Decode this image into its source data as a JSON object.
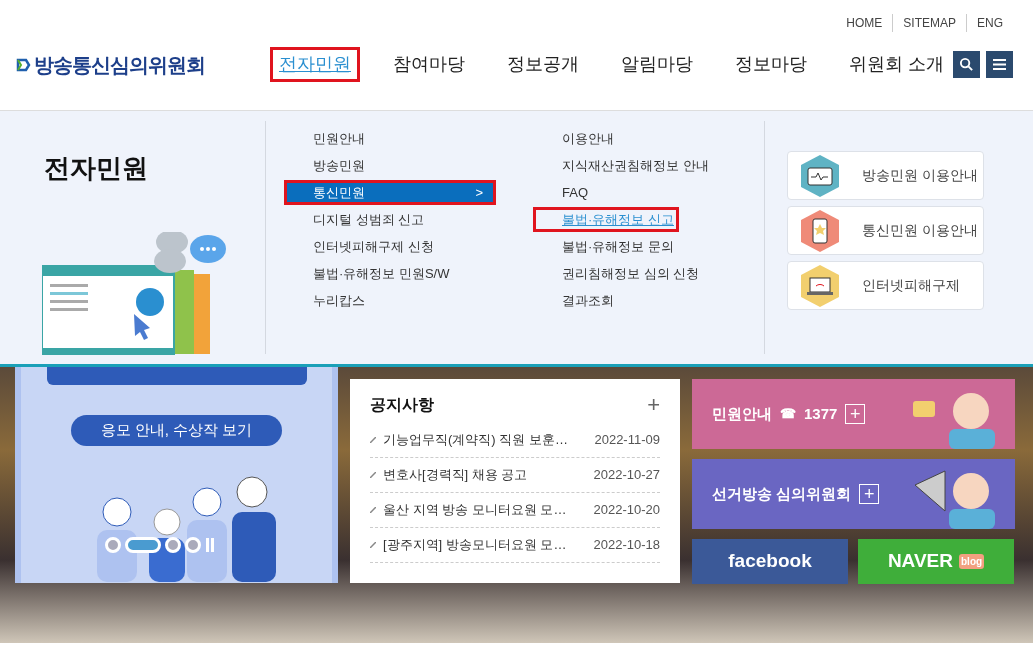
{
  "utility_links": [
    "HOME",
    "SITEMAP",
    "ENG"
  ],
  "logo": {
    "text": "방송통신심의위원회"
  },
  "nav": [
    {
      "label": "전자민원",
      "selected": true,
      "annotated": true
    },
    {
      "label": "참여마당",
      "selected": false,
      "annotated": false
    },
    {
      "label": "정보공개",
      "selected": false,
      "annotated": false
    },
    {
      "label": "알림마당",
      "selected": false,
      "annotated": false
    },
    {
      "label": "정보마당",
      "selected": false,
      "annotated": false
    },
    {
      "label": "위원회 소개",
      "selected": false,
      "annotated": false
    }
  ],
  "dropdown": {
    "title": "전자민원",
    "column_1": [
      {
        "label": "민원안내",
        "selected": false,
        "annotated": false
      },
      {
        "label": "방송민원",
        "selected": false,
        "annotated": false
      },
      {
        "label": "통신민원",
        "selected": true,
        "annotated": true,
        "chevron": ">"
      },
      {
        "label": "디지털 성범죄 신고",
        "selected": false,
        "annotated": false
      },
      {
        "label": "인터넷피해구제 신청",
        "selected": false,
        "annotated": false
      },
      {
        "label": "불법·유해정보 민원S/W",
        "selected": false,
        "annotated": false
      },
      {
        "label": "누리캅스",
        "selected": false,
        "annotated": false
      }
    ],
    "column_2": [
      {
        "label": "이용안내",
        "selected": false,
        "annotated": false
      },
      {
        "label": "지식재산권침해정보 안내",
        "selected": false,
        "annotated": false
      },
      {
        "label": "FAQ",
        "selected": false,
        "annotated": false
      },
      {
        "label": "불법·유해정보 신고",
        "selected": true,
        "annotated": true
      },
      {
        "label": "불법·유해정보 문의",
        "selected": false,
        "annotated": false
      },
      {
        "label": "권리침해정보 심의 신청",
        "selected": false,
        "annotated": false
      },
      {
        "label": "결과조회",
        "selected": false,
        "annotated": false
      }
    ],
    "guides": [
      {
        "label": "방송민원 이용안내",
        "kind": "monitor",
        "color": "#5fb3c4"
      },
      {
        "label": "통신민원 이용안내",
        "kind": "phone",
        "color": "#ef8a78"
      },
      {
        "label": "인터넷피해구제",
        "kind": "laptop",
        "color": "#f2cf6e"
      }
    ]
  },
  "banner": {
    "button": "응모 안내, 수상작 보기",
    "slides": [
      {
        "selected": false
      },
      {
        "selected": true
      },
      {
        "selected": false
      },
      {
        "selected": false
      }
    ]
  },
  "notices": {
    "title": "공지사항",
    "more": "+",
    "items": [
      {
        "title": "기능업무직(계약직) 직원 보훈…",
        "date": "2022-11-09"
      },
      {
        "title": "변호사[경력직] 채용 공고",
        "date": "2022-10-27"
      },
      {
        "title": "울산 지역 방송 모니터요원 모…",
        "date": "2022-10-20"
      },
      {
        "title": "[광주지역] 방송모니터요원 모…",
        "date": "2022-10-18"
      }
    ]
  },
  "quick_links": [
    {
      "label": "민원안내",
      "phone_icon": "☎",
      "phone": "1377",
      "plus": "+",
      "color": "#cc6996"
    },
    {
      "label": "선거방송 심의위원회",
      "plus": "+",
      "color": "#6a66c2"
    }
  ],
  "social": [
    {
      "label": "facebook",
      "kind": "facebook"
    },
    {
      "label": "NAVER",
      "badge": "blog",
      "kind": "naver"
    }
  ]
}
